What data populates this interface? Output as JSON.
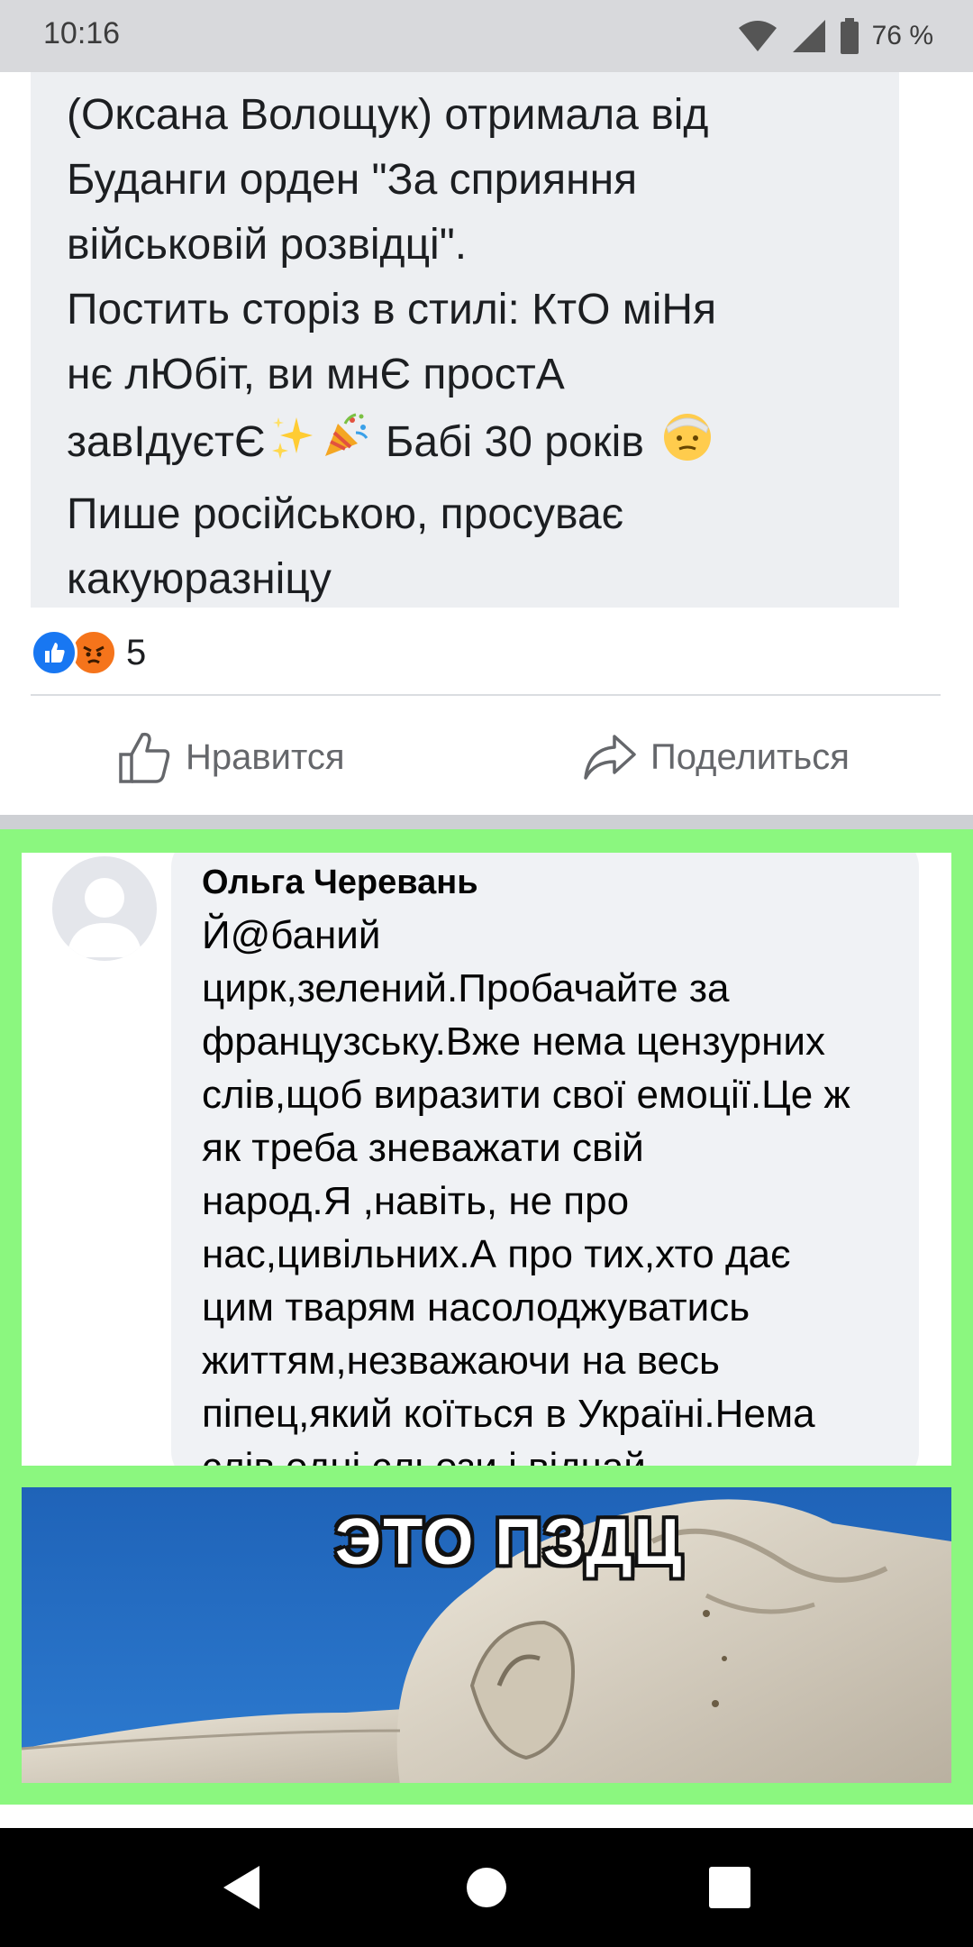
{
  "status_bar": {
    "time": "10:16",
    "battery": "76 %",
    "icons": [
      "wifi-icon",
      "signal-icon",
      "battery-icon"
    ]
  },
  "post": {
    "text": "(Оксана Волощук) отримала від\nБуданги орден \"За сприяння\nвійськовій розвідці\".\nПостить сторіз в стилі: КтО міНя\nнє лЮбіт, ви мнЄ простА\nзавІдуєтЄ",
    "text_tail_1": " Бабі 30 років ",
    "text_tail_2": "\nПише російською, просуває\nкакуюразніцу",
    "emojis": [
      "sparkles-icon",
      "party-popper-icon",
      "injured-face-icon"
    ]
  },
  "reactions": {
    "icons": [
      "like-reaction-icon",
      "angry-reaction-icon"
    ],
    "count": "5"
  },
  "actions": {
    "like_label": "Нравится",
    "share_label": "Поделиться"
  },
  "comment": {
    "author": "Ольга Черевань",
    "text": "Й@баний\nцирк,зелений.Пробачайте за\nфранцузську.Вже нема цензурних\nслів,щоб виразити свої емоції.Це ж\nяк треба зневажати свій\nнарод.Я ,навіть, не про\nнас,цивільних.А про тих,хто дає\nцим тварям насолоджуватись\nжиттям,незважаючи на весь\nпіпец,який коїться в Україні.Нема\nслів,одні сльози і відчай."
  },
  "meme": {
    "caption": "ЭТО ПЗДЦ"
  },
  "colors": {
    "highlight": "#8bf77f",
    "facebook_blue": "#1877f2",
    "angry_orange": "#f5741b"
  },
  "nav_bar": {
    "buttons": [
      "back-icon",
      "home-icon",
      "recents-icon"
    ]
  }
}
